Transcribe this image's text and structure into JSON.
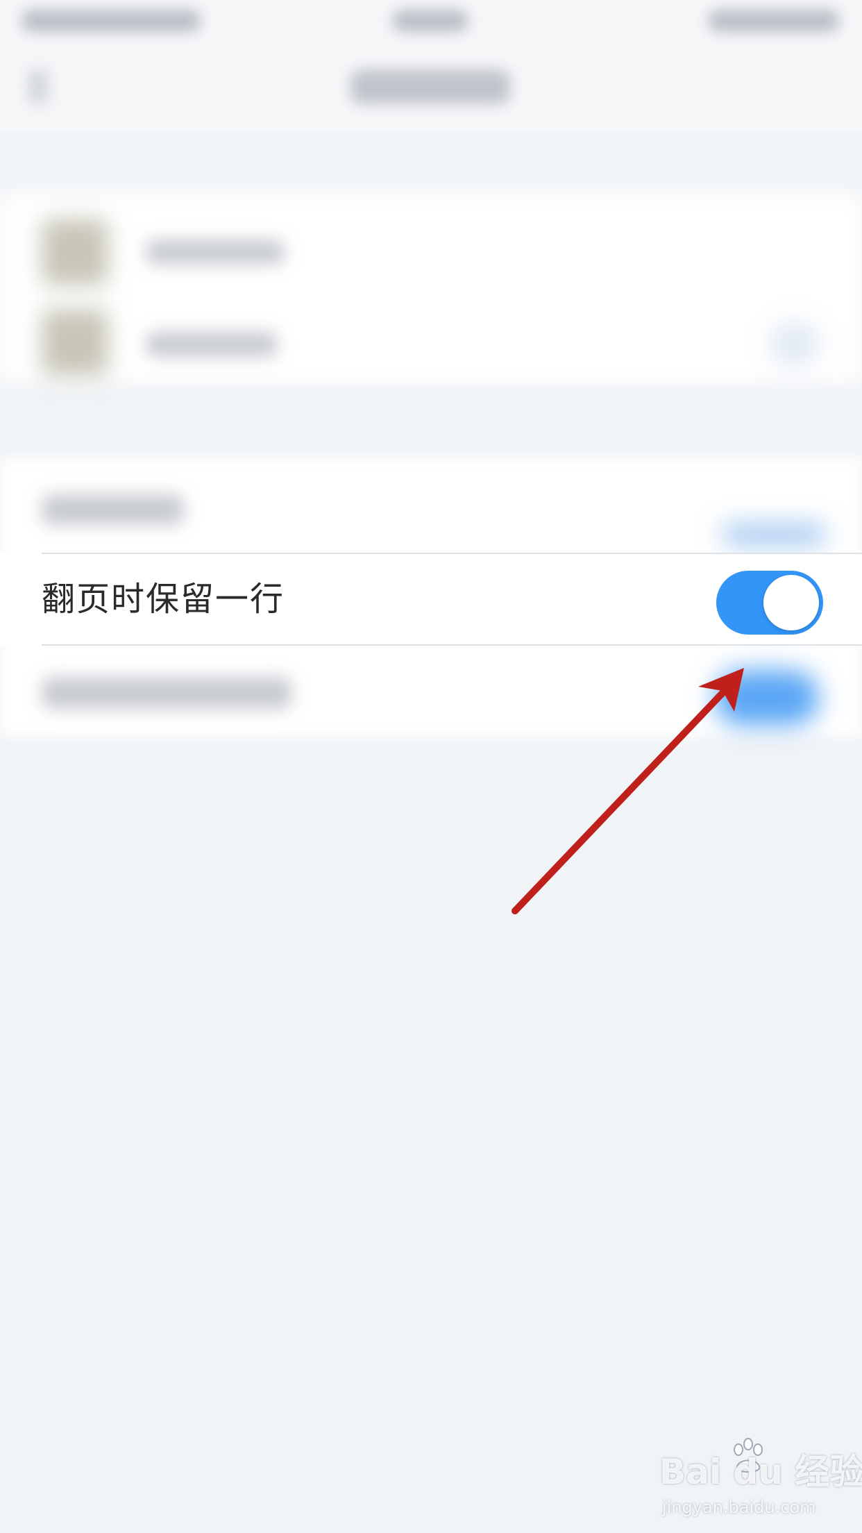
{
  "setting": {
    "label": "翻页时保留一行",
    "toggle_on": true
  },
  "colors": {
    "toggle_on": "#3295f7",
    "arrow": "#c0201b",
    "background": "#f1f4f7"
  },
  "watermark": {
    "brand": "Bai du 经验",
    "url": "jingyan.baidu.com"
  },
  "icons": {
    "annotation": "red-arrow-icon",
    "watermark_logo": "baidu-paw-icon"
  }
}
